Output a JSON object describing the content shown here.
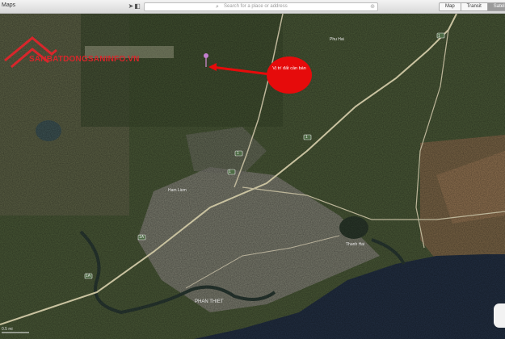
{
  "toolbar": {
    "left_label": "Maps",
    "search_placeholder": "Search for a place or address",
    "view_modes": [
      "Map",
      "Transit",
      "Satellite"
    ],
    "selected_mode": "Satellite"
  },
  "map": {
    "logo": {
      "brand": "SÀN BẤT ĐỘNG SẢN",
      "text": "SANBATDONGSANINFO.VN",
      "color": "#d8262b"
    },
    "callout": {
      "text": "Vị trí đất cần bán",
      "color": "#e60b0b"
    },
    "city_label": "PHAN THIET",
    "route_badges": [
      "1",
      "1",
      "1",
      "1",
      "1A",
      "1A"
    ],
    "place_labels": [
      "Ham Liem",
      "Phu Hai",
      "Thanh Hai"
    ],
    "colors": {
      "land": "#4b5a38",
      "sea": "#233044",
      "river": "#2a3a33",
      "urban": "#8d8b83"
    }
  },
  "scale_bar": {
    "label": "0.5 mi"
  }
}
